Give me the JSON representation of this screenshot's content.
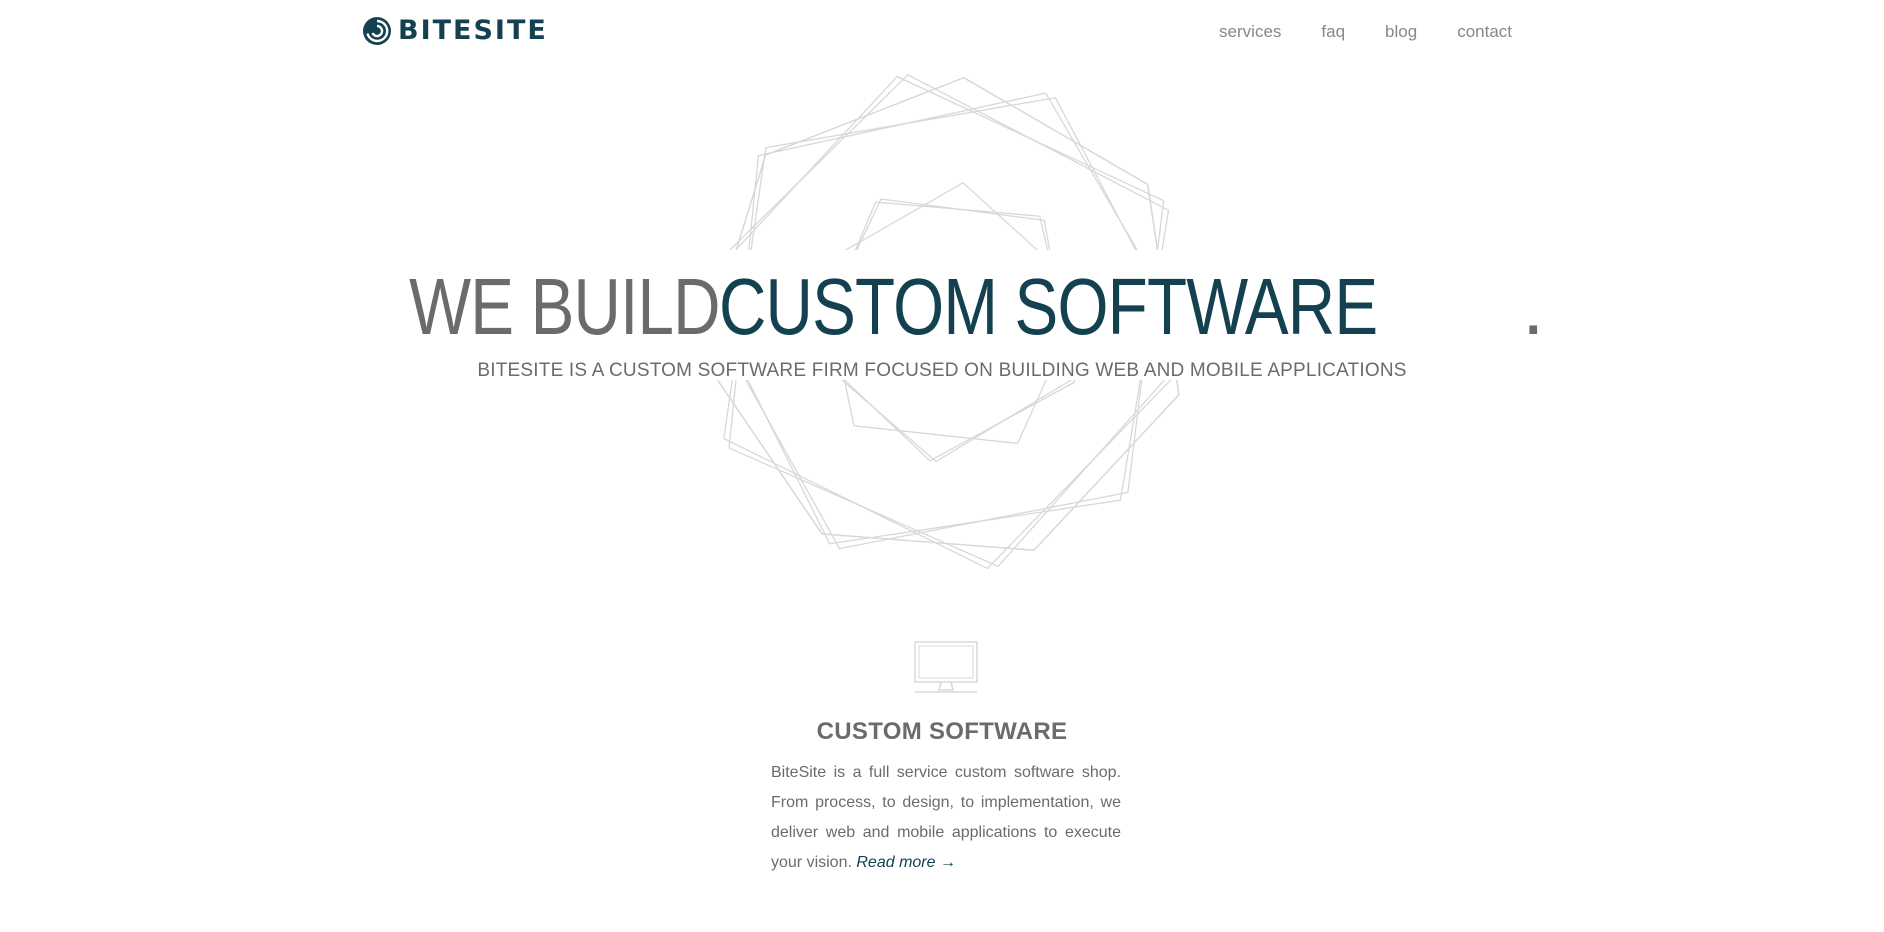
{
  "brand": {
    "name": "BITESITE",
    "logo_icon": "bitesite-swirl-logo-icon",
    "color": "#14414f"
  },
  "nav": {
    "items": [
      {
        "label": "services"
      },
      {
        "label": "faq"
      },
      {
        "label": "blog"
      },
      {
        "label": "contact"
      }
    ]
  },
  "hero": {
    "title_light": "WE BUILD ",
    "title_dark": "CUSTOM SOFTWARE",
    "title_end": ".",
    "subtitle": "BITESITE IS A CUSTOM SOFTWARE FIRM FOCUSED ON BUILDING WEB AND MOBILE APPLICATIONS",
    "background_art": "geometric-ring-art"
  },
  "feature": {
    "icon": "monitor-icon",
    "title": "CUSTOM SOFTWARE",
    "body": "BiteSite is a full service custom software shop. From process, to design, to implementation, we deliver web and mobile applications to execute your vision. ",
    "link_label": "Read more →"
  },
  "colors": {
    "accent": "#14414f",
    "text": "#6b6b6b",
    "nav": "#888888",
    "art_stroke": "#d8d8d8"
  }
}
